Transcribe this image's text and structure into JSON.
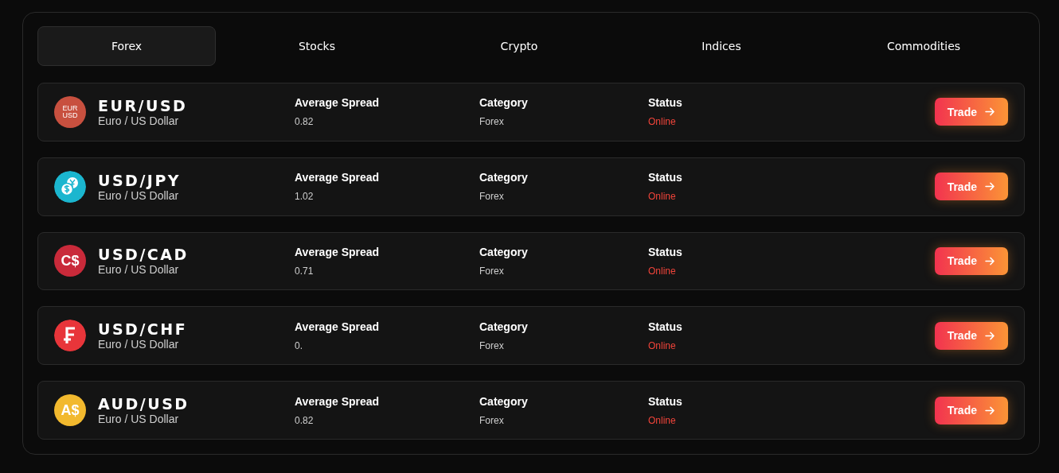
{
  "tabs": [
    {
      "label": "Forex",
      "selected": true
    },
    {
      "label": "Stocks",
      "selected": false
    },
    {
      "label": "Crypto",
      "selected": false
    },
    {
      "label": "Indices",
      "selected": false
    },
    {
      "label": "Commodities",
      "selected": false
    }
  ],
  "pairs": [
    {
      "symbol": "EUR/USD",
      "name": "Euro / US Dollar",
      "icon": {
        "kind": "text",
        "lines": [
          "EUR",
          "USD"
        ],
        "color": "#c8503f"
      },
      "spread_label": "Average Spread",
      "spread": "0.82",
      "category_label": "Category",
      "category": "Forex",
      "status_label": "Status",
      "status": "Online",
      "button": "Trade"
    },
    {
      "symbol": "USD/JPY",
      "name": "Euro / US Dollar",
      "icon": {
        "kind": "coins",
        "color": "#1bb6cf"
      },
      "spread_label": "Average Spread",
      "spread": "1.02",
      "category_label": "Category",
      "category": "Forex",
      "status_label": "Status",
      "status": "Online",
      "button": "Trade"
    },
    {
      "symbol": "USD/CAD",
      "name": "Euro / US Dollar",
      "icon": {
        "kind": "text",
        "lines": [
          "C$"
        ],
        "color": "#c92a3a"
      },
      "spread_label": "Average Spread",
      "spread": "0.71",
      "category_label": "Category",
      "category": "Forex",
      "status_label": "Status",
      "status": "Online",
      "button": "Trade"
    },
    {
      "symbol": "USD/CHF",
      "name": "Euro / US Dollar",
      "icon": {
        "kind": "franc",
        "color": "#e8353a"
      },
      "spread_label": "Average Spread",
      "spread": "0.",
      "category_label": "Category",
      "category": "Forex",
      "status_label": "Status",
      "status": "Online",
      "button": "Trade"
    },
    {
      "symbol": "AUD/USD",
      "name": "Euro / US Dollar",
      "icon": {
        "kind": "text",
        "lines": [
          "A$"
        ],
        "color": "#f2b92e"
      },
      "spread_label": "Average Spread",
      "spread": "0.82",
      "category_label": "Category",
      "category": "Forex",
      "status_label": "Status",
      "status": "Online",
      "button": "Trade"
    }
  ]
}
